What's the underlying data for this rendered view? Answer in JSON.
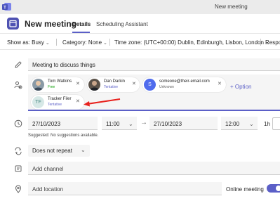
{
  "window": {
    "title": "New meeting"
  },
  "header": {
    "title": "New meeting",
    "tabs": [
      {
        "label": "Details",
        "selected": true
      },
      {
        "label": "Scheduling Assistant",
        "selected": false
      }
    ]
  },
  "options": {
    "show_as": "Show as: Busy",
    "category": "Category: None",
    "time_zone": "Time zone: (UTC+00:00) Dublin, Edinburgh, Lisbon, London",
    "response": "Respo"
  },
  "title_field": {
    "value": "Meeting to discuss things"
  },
  "attendees": [
    {
      "name": "Tom Watkins",
      "status": "Free",
      "status_color": "#13a10e"
    },
    {
      "name": "Dan Darkin",
      "status": "Tentative",
      "status_color": "#5b5fc7"
    },
    {
      "name": "someone@their-email.com",
      "status": "Unknown",
      "initial": "S",
      "avatar_color": "#4f6bed"
    },
    {
      "name": "Tracker Filer",
      "status": "Tentative",
      "initials": "TF",
      "status_color": "#5b5fc7",
      "avatar_color": "#d6e8e6",
      "avatar_text_color": "#4a8a84"
    }
  ],
  "optional_link": "+ Option",
  "date_time": {
    "start_date": "27/10/2023",
    "start_time": "11:00",
    "arrow": "→",
    "end_date": "27/10/2023",
    "end_time": "12:00",
    "duration": "1h"
  },
  "suggestion_text": "Suggested: No suggestions available.",
  "repeat": {
    "value": "Does not repeat"
  },
  "channel": {
    "placeholder": "Add channel"
  },
  "location": {
    "placeholder": "Add location"
  },
  "online_meeting": {
    "label": "Online meeting",
    "enabled": true
  },
  "colors": {
    "accent": "#5b5fc7",
    "annotation_arrow": "#e8221e",
    "field_bg": "#f5f5f5"
  }
}
